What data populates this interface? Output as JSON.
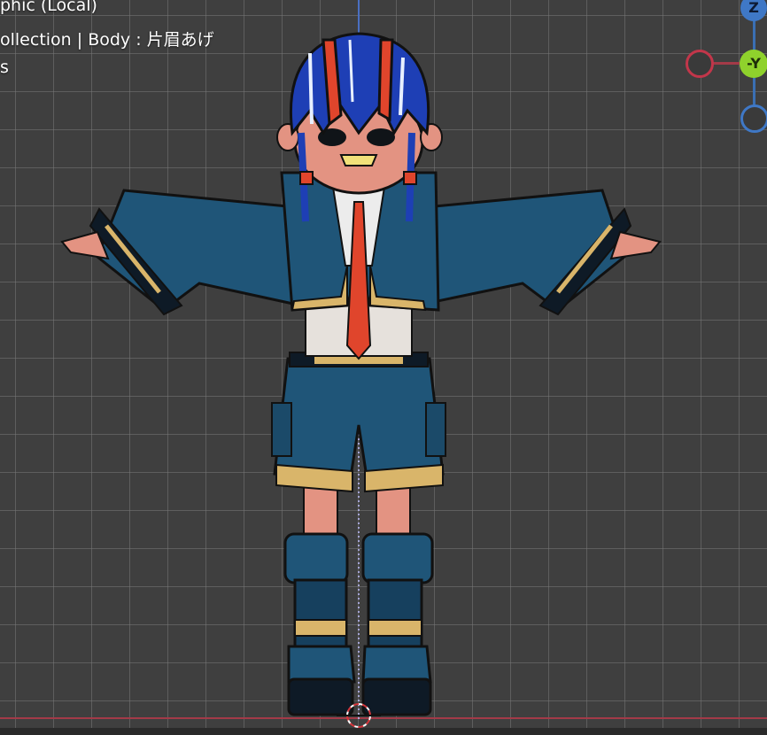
{
  "viewport": {
    "mode_text": "phic (Local)",
    "collection_text": "ollection | Body : 片眉あげ",
    "extra_text": "s"
  },
  "gizmo": {
    "z_label": "Z",
    "y_label": "-Y"
  },
  "colors": {
    "background": "#3f3f3f",
    "grid": "#6e6e6e",
    "axis_x": "#c2364a",
    "axis_y": "#8fd22c",
    "axis_z": "#3f78c6",
    "jacket": "#1f5578",
    "trim": "#d9b56a",
    "skin": "#e39382",
    "hair": "#1e3fb5",
    "horn": "#e0452c"
  },
  "objects": {
    "character_icon": "anime-character-model",
    "cursor_icon": "3d-cursor-icon"
  }
}
